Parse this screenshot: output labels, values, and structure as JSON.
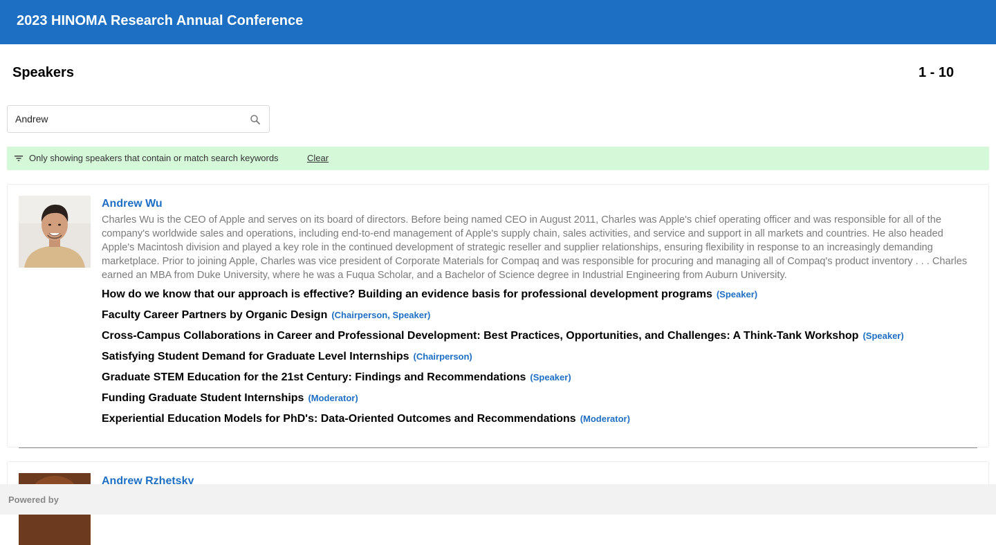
{
  "header": {
    "title": "2023 HINOMA Research Annual Conference"
  },
  "section": {
    "title": "Speakers",
    "range": "1 - 10"
  },
  "search": {
    "value": "Andrew",
    "icon": "search-icon"
  },
  "filter": {
    "icon": "filter-icon",
    "message": "Only showing speakers that contain or match search keywords",
    "clear_label": "Clear"
  },
  "speakers": [
    {
      "name": "Andrew Wu",
      "bio": "Charles Wu is the CEO of Apple and serves on its board of directors. Before being named CEO in August 2011, Charles was Apple's chief operating officer and was responsible for all of the company's worldwide sales and operations, including end-to-end management of Apple's supply chain, sales activities, and service and support in all markets and countries. He also headed Apple's Macintosh division and played a key role in the continued development of strategic reseller and supplier relationships, ensuring flexibility in response to an increasingly demanding marketplace. Prior to joining Apple, Charles was vice president of Corporate Materials for Compaq and was responsible for procuring and managing all of Compaq's product inventory . . . Charles earned an MBA from Duke University, where he was a Fuqua Scholar, and a Bachelor of Science degree in Industrial Engineering from Auburn University.",
      "sessions": [
        {
          "title": "How do we know that our approach is effective? Building an evidence basis for professional development programs",
          "role": "(Speaker)"
        },
        {
          "title": "Faculty Career Partners by Organic Design",
          "role": "(Chairperson, Speaker)"
        },
        {
          "title": "Cross-Campus Collaborations in Career and Professional Development: Best Practices, Opportunities, and Challenges: A Think-Tank Workshop",
          "role": "(Speaker)"
        },
        {
          "title": "Satisfying Student Demand for Graduate Level Internships",
          "role": "(Chairperson)"
        },
        {
          "title": "Graduate STEM Education for the 21st Century: Findings and Recommendations",
          "role": "(Speaker)"
        },
        {
          "title": "Funding Graduate Student Internships",
          "role": "(Moderator)"
        },
        {
          "title": "Experiential Education Models for PhD's: Data-Oriented Outcomes and Recommendations",
          "role": "(Moderator)"
        }
      ]
    },
    {
      "name": "Andrew Rzhetsky"
    }
  ],
  "footer": {
    "powered_by": "Powered by"
  },
  "colors": {
    "accent": "#1d6fc4",
    "filter_bg": "#d5f8d9",
    "bio_text": "#7a7a7a",
    "footer_bg": "#f2f2f2"
  }
}
